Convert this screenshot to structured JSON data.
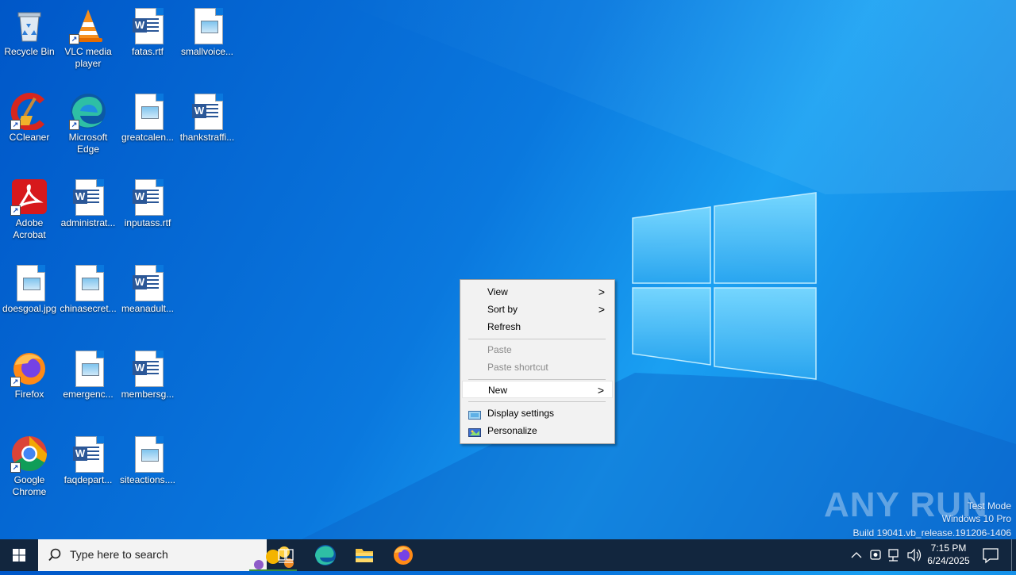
{
  "desktop": {
    "icons": [
      {
        "label": "Recycle Bin",
        "icon": "recycle-bin-icon"
      },
      {
        "label": "VLC media player",
        "icon": "vlc-icon"
      },
      {
        "label": "fatas.rtf",
        "icon": "word-document-icon"
      },
      {
        "label": "smallvoice...",
        "icon": "image-file-icon"
      },
      {
        "label": "CCleaner",
        "icon": "ccleaner-icon"
      },
      {
        "label": "Microsoft Edge",
        "icon": "edge-icon"
      },
      {
        "label": "greatcalen...",
        "icon": "image-file-icon"
      },
      {
        "label": "thankstraffi...",
        "icon": "word-document-icon"
      },
      {
        "label": "Adobe Acrobat",
        "icon": "acrobat-icon"
      },
      {
        "label": "administrat...",
        "icon": "word-document-icon"
      },
      {
        "label": "inputass.rtf",
        "icon": "word-document-icon"
      },
      {
        "label": "doesgoal.jpg",
        "icon": "image-file-icon"
      },
      {
        "label": "chinasecret...",
        "icon": "image-file-icon"
      },
      {
        "label": "meanadult...",
        "icon": "word-document-icon"
      },
      {
        "label": "Firefox",
        "icon": "firefox-icon"
      },
      {
        "label": "emergenc...",
        "icon": "image-file-icon"
      },
      {
        "label": "membersg...",
        "icon": "word-document-icon"
      },
      {
        "label": "Google Chrome",
        "icon": "chrome-icon"
      },
      {
        "label": "faqdepart...",
        "icon": "word-document-icon"
      },
      {
        "label": "siteactions....",
        "icon": "image-file-icon"
      }
    ]
  },
  "context_menu": {
    "items": [
      {
        "label": "View",
        "has_submenu": true,
        "enabled": true
      },
      {
        "label": "Sort by",
        "has_submenu": true,
        "enabled": true
      },
      {
        "label": "Refresh",
        "has_submenu": false,
        "enabled": true
      },
      {
        "label": "Paste",
        "has_submenu": false,
        "enabled": false
      },
      {
        "label": "Paste shortcut",
        "has_submenu": false,
        "enabled": false
      },
      {
        "label": "New",
        "has_submenu": true,
        "enabled": true,
        "highlighted": true
      },
      {
        "label": "Display settings",
        "has_submenu": false,
        "enabled": true,
        "icon": "display-icon"
      },
      {
        "label": "Personalize",
        "has_submenu": false,
        "enabled": true,
        "icon": "personalize-icon"
      }
    ],
    "submenu_arrow": ">"
  },
  "watermark": {
    "brand": "ANY RUN",
    "mode": "Test Mode",
    "edition": "Windows 10 Pro",
    "build": "Build 19041.vb_release.191206-1406"
  },
  "taskbar": {
    "search_placeholder": "Type here to search",
    "pinned": [
      "task-view-icon",
      "edge-icon",
      "file-explorer-icon",
      "firefox-icon"
    ],
    "clock_time": "7:15 PM",
    "clock_date": "6/24/2025"
  },
  "colors": {
    "wallpaper": "#0a78de",
    "taskbar": "#12263e",
    "menu_bg": "#f2f2f2"
  }
}
